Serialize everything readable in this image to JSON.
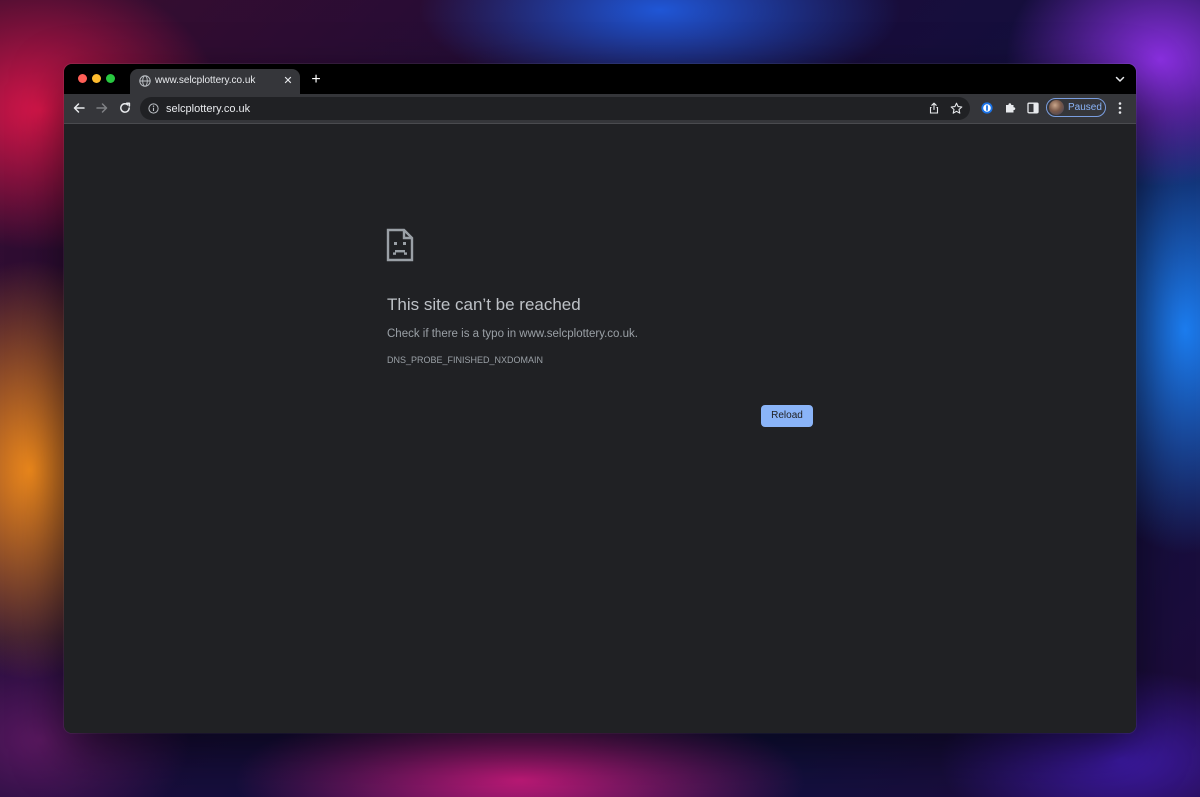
{
  "browser": {
    "tab": {
      "title": "www.selcplottery.co.uk",
      "close_icon": "close-icon",
      "favicon": "globe-icon"
    },
    "new_tab_icon": "plus-icon",
    "tab_search_icon": "chevron-down-icon",
    "toolbar": {
      "back_icon": "arrow-left-icon",
      "forward_icon": "arrow-right-icon",
      "reload_icon": "reload-icon",
      "site_info_icon": "info-icon",
      "url": "selcplottery.co.uk",
      "share_icon": "share-icon",
      "bookmark_icon": "star-icon",
      "extensions": [
        "1password-icon",
        "puzzle-icon",
        "side-panel-icon"
      ],
      "profile_label": "Paused",
      "menu_icon": "kebab-menu-icon"
    }
  },
  "error_page": {
    "icon": "sad-page-icon",
    "title": "This site can’t be reached",
    "description": "Check if there is a typo in www.selcplottery.co.uk.",
    "code": "DNS_PROBE_FINISHED_NXDOMAIN",
    "reload_label": "Reload"
  },
  "colors": {
    "accent": "#8ab4f8",
    "page_bg": "#202124",
    "toolbar_bg": "#35363a",
    "tabstrip_bg": "#000000"
  }
}
